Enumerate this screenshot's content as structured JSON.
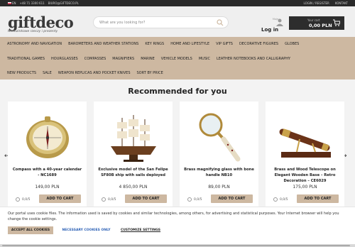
{
  "topbar": {
    "lang": "EN",
    "phone": "+48 71 3300 611",
    "email": "BIURO@GIFTDECO.PL",
    "login_link": "LOGIN / REGISTER",
    "contact_link": "KONTAKT"
  },
  "header": {
    "logo": "giftdeco",
    "tagline": "Nietuzinkowe rzeczy i prezenty",
    "search_placeholder": "What are you looking for?",
    "account_small": "Moje",
    "login_label": "Log in",
    "cart_small": "Your cart",
    "cart_amount": "0,00 PLN"
  },
  "nav": {
    "row1": [
      "ASTRONOMY AND NAVIGATION",
      "BAROMETERS AND WEATHER STATIONS",
      "KEY RINGS",
      "HOME AND LIFESTYLE",
      "VIP GIFTS",
      "DECORATIVE FIGURES",
      "GLOBES"
    ],
    "row2": [
      "TRADITIONAL GAMES",
      "HOURGLASSES",
      "COMPASSES",
      "MAGNIFIERS",
      "MARINE",
      "VEHICLE MODELS",
      "MUSIC",
      "LEATHER NOTEBOOKS AND CALLIGRAPHY"
    ],
    "row3": [
      "NEW PRODUCTS",
      "SALE",
      "WEAPON REPLICAS AND POCKET KNIVES",
      "SORT BY PRICE"
    ]
  },
  "recommended": {
    "title": "Recommended for you",
    "products": [
      {
        "name": "Compass with a 40-year calendar - NC1689",
        "price": "149,00 PLN",
        "rating": "0,0/5",
        "button": "ADD TO CART"
      },
      {
        "name": "Exclusive model of the San Felipe SF80B ship with sails deployed",
        "price": "4 850,00 PLN",
        "rating": "0,0/5",
        "button": "ADD TO CART"
      },
      {
        "name": "Brass magnifying glass with bone handle NB10",
        "price": "89,00 PLN",
        "rating": "0,0/5",
        "button": "ADD TO CART"
      },
      {
        "name": "Brass and Wood Telescope on Elegant Wooden Base – Retro Decoration – CE6029",
        "price": "175,00 PLN",
        "rating": "0,0/5",
        "button": "ADD TO CART"
      }
    ]
  },
  "cookie": {
    "text": "Our portal uses cookie files. The information used is saved by cookies and similar technologies, among others, for advertising and statistical purposes. Your Internet browser will help you change the cookie settings.",
    "accept_all": "ACCEPT ALL COOKIES",
    "necessary": "NECESSARY COOKIES ONLY",
    "customize": "CUSTOMIZE SETTINGS"
  },
  "colors": {
    "accent": "#cdb8a1",
    "dark": "#2a2a2a",
    "link": "#2a5fb5"
  }
}
